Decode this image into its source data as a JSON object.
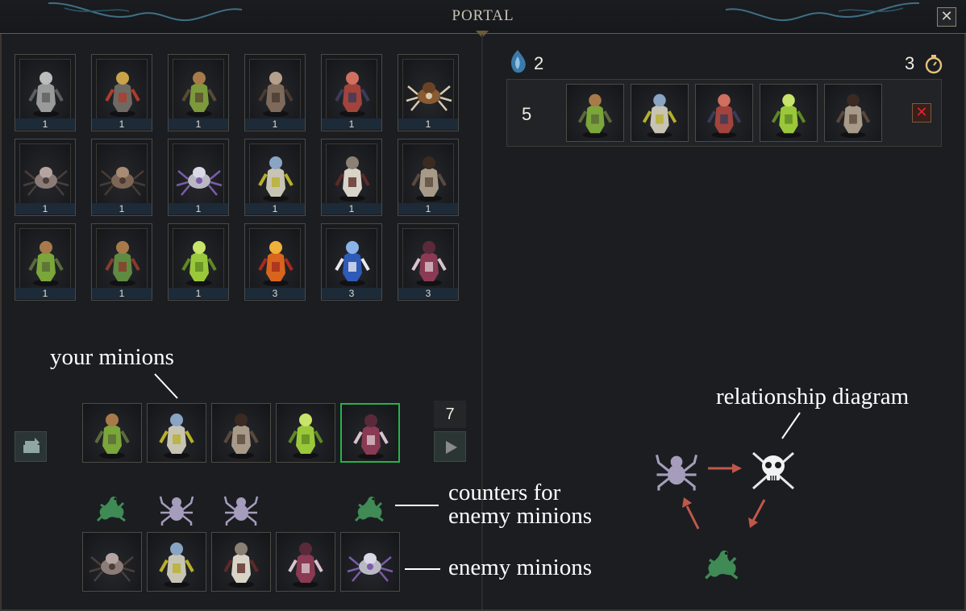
{
  "window": {
    "title": "PORTAL",
    "close_label": "✕"
  },
  "roster": [
    {
      "name": "armored-knight",
      "count": "1"
    },
    {
      "name": "horned-goblin",
      "count": "1"
    },
    {
      "name": "goblin-archer",
      "count": "1"
    },
    {
      "name": "rat-shieldbearer",
      "count": "1"
    },
    {
      "name": "red-ratman",
      "count": "1"
    },
    {
      "name": "porcupine",
      "count": "1"
    },
    {
      "name": "scorpion",
      "count": "1"
    },
    {
      "name": "brown-spider",
      "count": "1"
    },
    {
      "name": "crystal-spider",
      "count": "1"
    },
    {
      "name": "skeleton-shield",
      "count": "1"
    },
    {
      "name": "skeleton",
      "count": "1"
    },
    {
      "name": "pirate",
      "count": "1"
    },
    {
      "name": "lizard-club",
      "count": "1"
    },
    {
      "name": "lizard-spear",
      "count": "1"
    },
    {
      "name": "green-ghoul",
      "count": "1"
    },
    {
      "name": "fire-mage",
      "count": "3"
    },
    {
      "name": "blue-mage",
      "count": "3"
    },
    {
      "name": "dark-mage",
      "count": "3"
    }
  ],
  "header_stats": {
    "essence": "2",
    "timer": "3"
  },
  "wave": {
    "number": "5",
    "units": [
      "lizard-club",
      "skeleton-shield",
      "red-ratman",
      "green-ghoul",
      "pirate"
    ],
    "remove_label": "✕"
  },
  "your_minions": {
    "units": [
      "lizard-club",
      "skeleton-shield",
      "pirate",
      "green-ghoul",
      "dark-mage"
    ],
    "selected_index": 4,
    "remaining": "7"
  },
  "counters": [
    "lizard",
    "spider",
    "spider",
    "",
    "lizard"
  ],
  "enemy_minions": [
    "scorpion",
    "skeleton-shield",
    "skeleton",
    "dark-mage",
    "crystal-spider"
  ],
  "annotations": {
    "your_minions": "your minions",
    "counters_line1": "counters for",
    "counters_line2": "enemy minions",
    "enemy_minions": "enemy minions",
    "relationship": "relationship diagram"
  },
  "colors": {
    "spider": "#a59dbb",
    "lizard": "#3f8a55",
    "arrow": "#c0584a",
    "selected": "#27b24a",
    "count_bar": "#1d2a38"
  }
}
